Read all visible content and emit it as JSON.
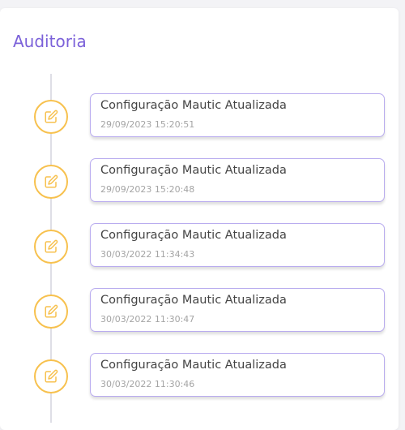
{
  "page": {
    "title": "Auditoria"
  },
  "timeline": {
    "items": [
      {
        "icon": "edit-icon",
        "title": "Configuração Mautic Atualizada",
        "timestamp": "29/09/2023 15:20:51"
      },
      {
        "icon": "edit-icon",
        "title": "Configuração Mautic Atualizada",
        "timestamp": "29/09/2023 15:20:48"
      },
      {
        "icon": "edit-icon",
        "title": "Configuração Mautic Atualizada",
        "timestamp": "30/03/2022 11:34:43"
      },
      {
        "icon": "edit-icon",
        "title": "Configuração Mautic Atualizada",
        "timestamp": "30/03/2022 11:30:47"
      },
      {
        "icon": "edit-icon",
        "title": "Configuração Mautic Atualizada",
        "timestamp": "30/03/2022 11:30:46"
      }
    ]
  },
  "colors": {
    "accent": "#7b61d9",
    "marker_border": "#f7c14e",
    "box_border": "#b9acef"
  }
}
